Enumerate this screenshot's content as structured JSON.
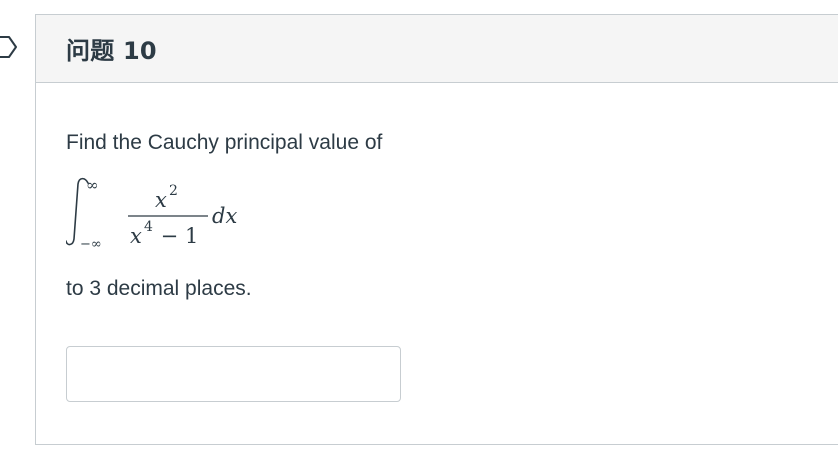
{
  "question": {
    "title": "问题 10",
    "prompt": "Find the Cauchy principal value of",
    "suffix": "to 3 decimal places.",
    "formula": {
      "upper_limit": "∞",
      "lower_limit": "−∞",
      "numerator_base": "x",
      "numerator_exp": "2",
      "denominator_base": "x",
      "denominator_exp": "4",
      "denominator_rest": " − 1",
      "differential": "dx"
    },
    "answer": {
      "value": ""
    }
  },
  "colors": {
    "text": "#2d3b45",
    "border": "#c7cdd1",
    "header_bg": "#f5f5f5"
  }
}
